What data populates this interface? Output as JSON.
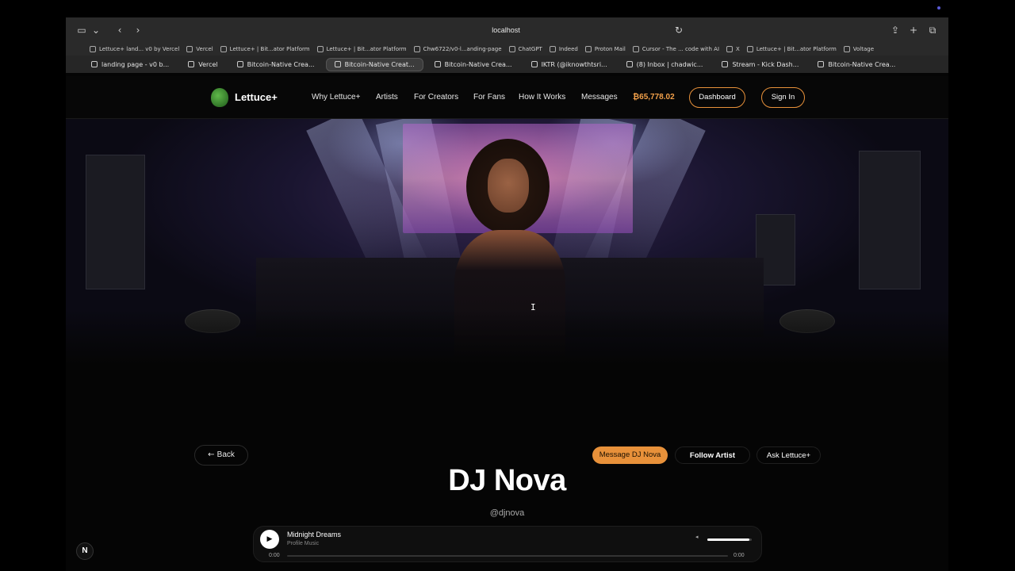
{
  "browser": {
    "url": "localhost",
    "bookmarks": [
      "Lettuce+ land... v0 by Vercel",
      "Vercel",
      "Lettuce+ | Bit...ator Platform",
      "Lettuce+ | Bit...ator Platform",
      "Chw6722/v0-l...anding-page",
      "ChatGPT",
      "Indeed",
      "Proton Mail",
      "Cursor - The ... code with AI",
      "X",
      "Lettuce+ | Bit...ator Platform",
      "Voltage"
    ],
    "tabs": [
      {
        "label": "landing page - v0 b...",
        "active": false
      },
      {
        "label": "Vercel",
        "active": false
      },
      {
        "label": "Bitcoin-Native Crea...",
        "active": false
      },
      {
        "label": "Bitcoin-Native Creat...",
        "active": true
      },
      {
        "label": "Bitcoin-Native Crea...",
        "active": false
      },
      {
        "label": "IKTR (@iknowthtsri...",
        "active": false
      },
      {
        "label": "(8) Inbox | chadwic...",
        "active": false
      },
      {
        "label": "Stream - Kick Dash...",
        "active": false
      },
      {
        "label": "Bitcoin-Native Crea...",
        "active": false
      }
    ]
  },
  "site": {
    "brand": "Lettuce+",
    "nav": [
      "Why Lettuce+",
      "Artists",
      "For Creators",
      "For Fans",
      "How It Works",
      "Messages"
    ],
    "balance": "₿65,778.02",
    "dashboard": "Dashboard",
    "sign_in": "Sign In",
    "accent": "#e8913a"
  },
  "profile": {
    "back": "Back",
    "message": "Message DJ Nova",
    "follow": "Follow Artist",
    "ask": "Ask Lettuce+",
    "name": "DJ Nova",
    "handle": "@djnova"
  },
  "player": {
    "title": "Midnight Dreams",
    "artist": "Profile Music",
    "time_start": "0:00",
    "time_end": "0:00",
    "progress": 0,
    "volume": 0.95
  },
  "dev_badge": "N"
}
